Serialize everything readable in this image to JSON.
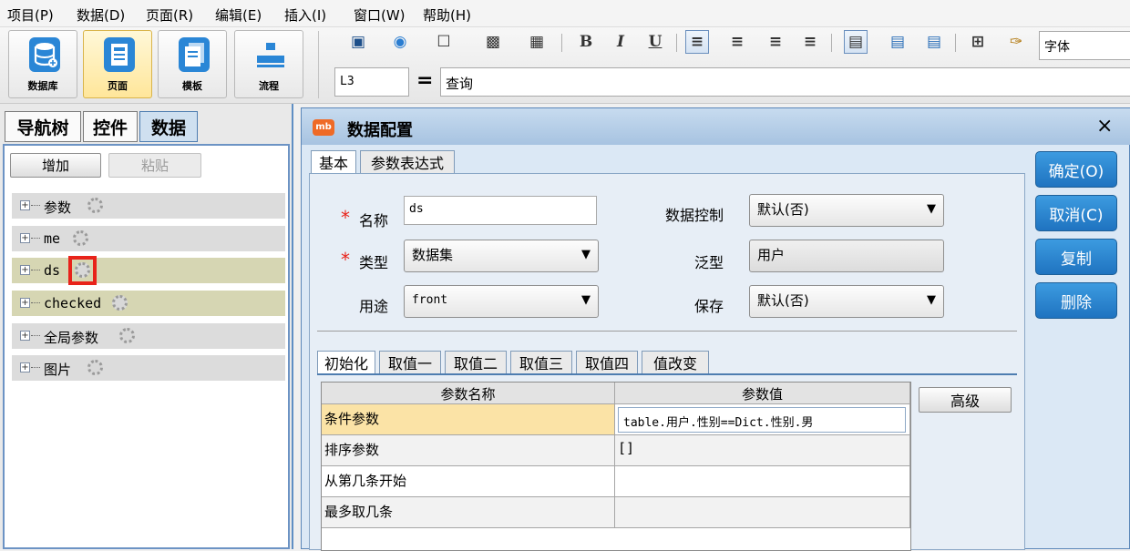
{
  "menu": [
    "项目(P)",
    "数据(D)",
    "页面(R)",
    "编辑(E)",
    "插入(I)",
    "窗口(W)",
    "帮助(H)"
  ],
  "ribbon": {
    "buttons": [
      {
        "label": "数据库"
      },
      {
        "label": "页面"
      },
      {
        "label": "模板"
      },
      {
        "label": "流程"
      }
    ],
    "font_label": "字体"
  },
  "formula": {
    "cell_ref": "L3",
    "eq": "=",
    "value": "查询"
  },
  "left": {
    "tabs": [
      "导航树",
      "控件",
      "数据"
    ],
    "add_btn": "增加",
    "paste_btn": "粘贴",
    "tree": [
      "参数",
      "me",
      "ds",
      "checked",
      "全局参数",
      "图片"
    ]
  },
  "dialog": {
    "title": "数据配置",
    "close": "×",
    "tabs": [
      "基本",
      "参数表达式"
    ],
    "required_mark": "*",
    "fields": {
      "name_label": "名称",
      "name_value": "ds",
      "type_label": "类型",
      "type_value": "数据集",
      "usage_label": "用途",
      "usage_value": "front",
      "datactl_label": "数据控制",
      "datactl_value": "默认(否)",
      "generic_label": "泛型",
      "generic_value": "用户",
      "save_label": "保存",
      "save_value": "默认(否)"
    },
    "sub_tabs": [
      "初始化",
      "取值一",
      "取值二",
      "取值三",
      "取值四",
      "值改变"
    ],
    "grid": {
      "headers": [
        "参数名称",
        "参数值"
      ],
      "rows": [
        {
          "name": "条件参数",
          "value": "table.用户.性别==Dict.性别.男"
        },
        {
          "name": "排序参数",
          "value": "[]"
        },
        {
          "name": "从第几条开始",
          "value": ""
        },
        {
          "name": "最多取几条",
          "value": ""
        }
      ]
    },
    "advanced_btn": "高级",
    "side_buttons": [
      "确定(O)",
      "取消(C)",
      "复制",
      "删除"
    ]
  },
  "colors": {
    "accent": "#1f73c0",
    "highlight_row": "#fbe3a6",
    "tree_highlight": "#d6d6b3",
    "annotation": "#e8231a"
  }
}
